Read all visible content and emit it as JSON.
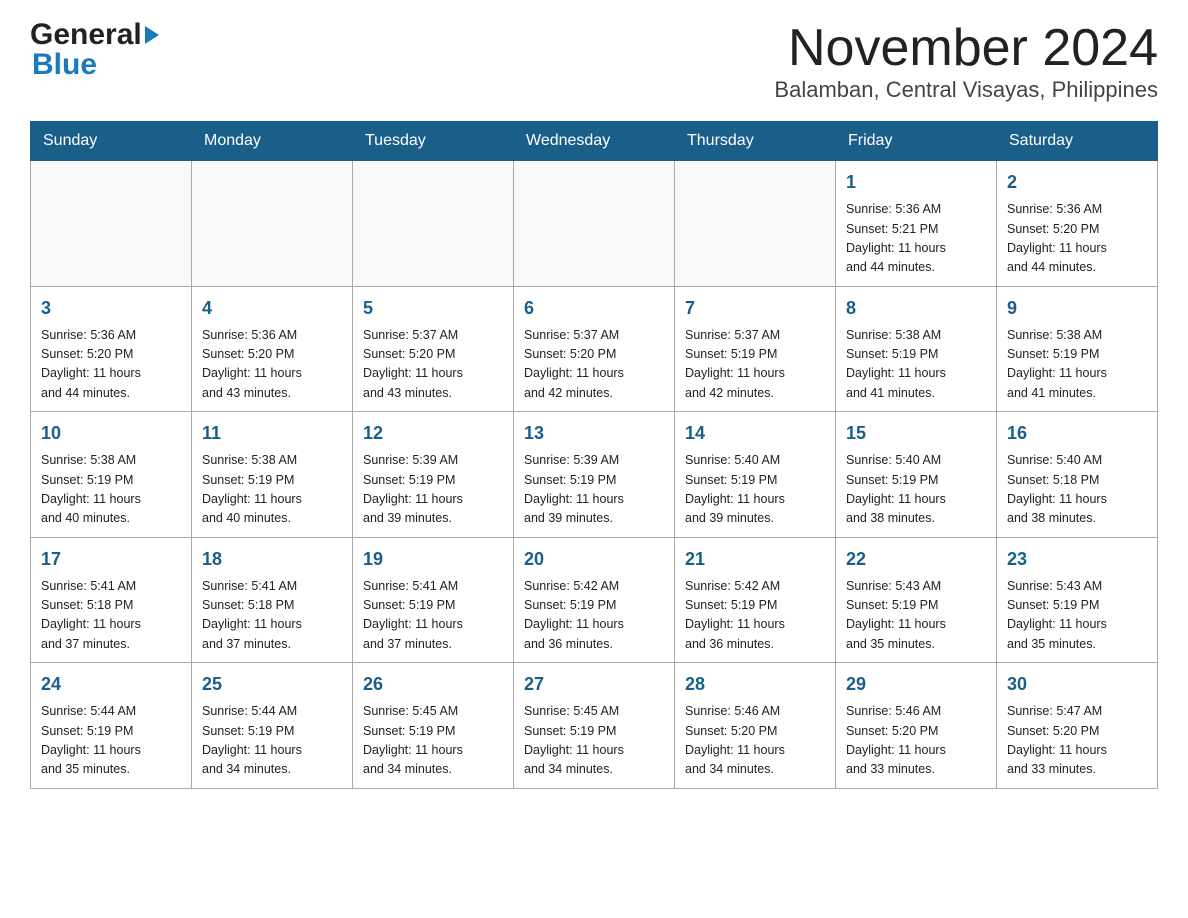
{
  "logo": {
    "line1": "General",
    "triangle": "▶",
    "line2": "Blue"
  },
  "title": "November 2024",
  "subtitle": "Balamban, Central Visayas, Philippines",
  "weekdays": [
    "Sunday",
    "Monday",
    "Tuesday",
    "Wednesday",
    "Thursday",
    "Friday",
    "Saturday"
  ],
  "weeks": [
    [
      {
        "day": "",
        "info": ""
      },
      {
        "day": "",
        "info": ""
      },
      {
        "day": "",
        "info": ""
      },
      {
        "day": "",
        "info": ""
      },
      {
        "day": "",
        "info": ""
      },
      {
        "day": "1",
        "info": "Sunrise: 5:36 AM\nSunset: 5:21 PM\nDaylight: 11 hours\nand 44 minutes."
      },
      {
        "day": "2",
        "info": "Sunrise: 5:36 AM\nSunset: 5:20 PM\nDaylight: 11 hours\nand 44 minutes."
      }
    ],
    [
      {
        "day": "3",
        "info": "Sunrise: 5:36 AM\nSunset: 5:20 PM\nDaylight: 11 hours\nand 44 minutes."
      },
      {
        "day": "4",
        "info": "Sunrise: 5:36 AM\nSunset: 5:20 PM\nDaylight: 11 hours\nand 43 minutes."
      },
      {
        "day": "5",
        "info": "Sunrise: 5:37 AM\nSunset: 5:20 PM\nDaylight: 11 hours\nand 43 minutes."
      },
      {
        "day": "6",
        "info": "Sunrise: 5:37 AM\nSunset: 5:20 PM\nDaylight: 11 hours\nand 42 minutes."
      },
      {
        "day": "7",
        "info": "Sunrise: 5:37 AM\nSunset: 5:19 PM\nDaylight: 11 hours\nand 42 minutes."
      },
      {
        "day": "8",
        "info": "Sunrise: 5:38 AM\nSunset: 5:19 PM\nDaylight: 11 hours\nand 41 minutes."
      },
      {
        "day": "9",
        "info": "Sunrise: 5:38 AM\nSunset: 5:19 PM\nDaylight: 11 hours\nand 41 minutes."
      }
    ],
    [
      {
        "day": "10",
        "info": "Sunrise: 5:38 AM\nSunset: 5:19 PM\nDaylight: 11 hours\nand 40 minutes."
      },
      {
        "day": "11",
        "info": "Sunrise: 5:38 AM\nSunset: 5:19 PM\nDaylight: 11 hours\nand 40 minutes."
      },
      {
        "day": "12",
        "info": "Sunrise: 5:39 AM\nSunset: 5:19 PM\nDaylight: 11 hours\nand 39 minutes."
      },
      {
        "day": "13",
        "info": "Sunrise: 5:39 AM\nSunset: 5:19 PM\nDaylight: 11 hours\nand 39 minutes."
      },
      {
        "day": "14",
        "info": "Sunrise: 5:40 AM\nSunset: 5:19 PM\nDaylight: 11 hours\nand 39 minutes."
      },
      {
        "day": "15",
        "info": "Sunrise: 5:40 AM\nSunset: 5:19 PM\nDaylight: 11 hours\nand 38 minutes."
      },
      {
        "day": "16",
        "info": "Sunrise: 5:40 AM\nSunset: 5:18 PM\nDaylight: 11 hours\nand 38 minutes."
      }
    ],
    [
      {
        "day": "17",
        "info": "Sunrise: 5:41 AM\nSunset: 5:18 PM\nDaylight: 11 hours\nand 37 minutes."
      },
      {
        "day": "18",
        "info": "Sunrise: 5:41 AM\nSunset: 5:18 PM\nDaylight: 11 hours\nand 37 minutes."
      },
      {
        "day": "19",
        "info": "Sunrise: 5:41 AM\nSunset: 5:19 PM\nDaylight: 11 hours\nand 37 minutes."
      },
      {
        "day": "20",
        "info": "Sunrise: 5:42 AM\nSunset: 5:19 PM\nDaylight: 11 hours\nand 36 minutes."
      },
      {
        "day": "21",
        "info": "Sunrise: 5:42 AM\nSunset: 5:19 PM\nDaylight: 11 hours\nand 36 minutes."
      },
      {
        "day": "22",
        "info": "Sunrise: 5:43 AM\nSunset: 5:19 PM\nDaylight: 11 hours\nand 35 minutes."
      },
      {
        "day": "23",
        "info": "Sunrise: 5:43 AM\nSunset: 5:19 PM\nDaylight: 11 hours\nand 35 minutes."
      }
    ],
    [
      {
        "day": "24",
        "info": "Sunrise: 5:44 AM\nSunset: 5:19 PM\nDaylight: 11 hours\nand 35 minutes."
      },
      {
        "day": "25",
        "info": "Sunrise: 5:44 AM\nSunset: 5:19 PM\nDaylight: 11 hours\nand 34 minutes."
      },
      {
        "day": "26",
        "info": "Sunrise: 5:45 AM\nSunset: 5:19 PM\nDaylight: 11 hours\nand 34 minutes."
      },
      {
        "day": "27",
        "info": "Sunrise: 5:45 AM\nSunset: 5:19 PM\nDaylight: 11 hours\nand 34 minutes."
      },
      {
        "day": "28",
        "info": "Sunrise: 5:46 AM\nSunset: 5:20 PM\nDaylight: 11 hours\nand 34 minutes."
      },
      {
        "day": "29",
        "info": "Sunrise: 5:46 AM\nSunset: 5:20 PM\nDaylight: 11 hours\nand 33 minutes."
      },
      {
        "day": "30",
        "info": "Sunrise: 5:47 AM\nSunset: 5:20 PM\nDaylight: 11 hours\nand 33 minutes."
      }
    ]
  ],
  "colors": {
    "header_bg": "#1a5f8a",
    "header_text": "#ffffff",
    "day_number": "#1a5f8a",
    "logo_blue": "#1a7abf"
  }
}
